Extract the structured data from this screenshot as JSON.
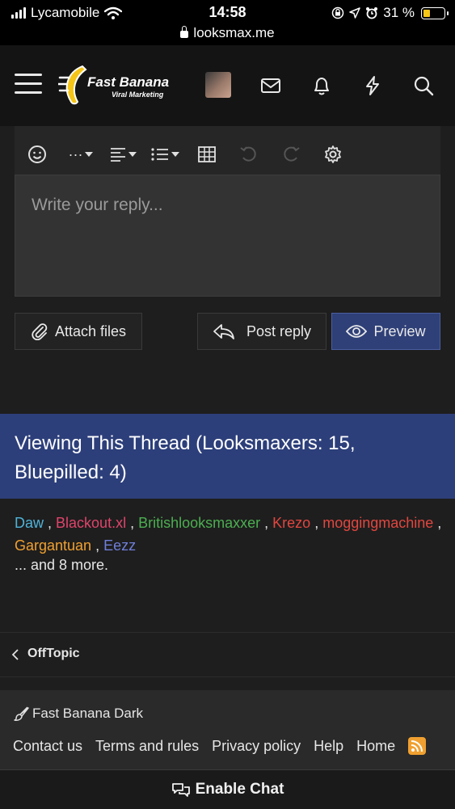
{
  "status_bar": {
    "carrier": "Lycamobile",
    "time": "14:58",
    "battery_percent": "31 %",
    "url": "looksmax.me",
    "icons": [
      "signal-icon",
      "wifi-icon",
      "screen-lock-icon",
      "location-icon",
      "alarm-icon",
      "battery-icon",
      "lock-icon"
    ]
  },
  "header": {
    "logo_brand": "Fast Banana",
    "logo_tagline": "Viral Marketing",
    "icons": [
      "menu-icon",
      "avatar",
      "inbox-icon",
      "bell-icon",
      "lightning-icon",
      "search-icon"
    ]
  },
  "editor": {
    "placeholder": "Write your reply...",
    "toolbar_icons": [
      "smiley-icon",
      "more-options-icon",
      "align-icon",
      "list-icon",
      "table-icon",
      "undo-icon",
      "redo-icon",
      "gear-icon"
    ],
    "more_label": "···"
  },
  "actions": {
    "attach": "Attach files",
    "post": "Post reply",
    "preview": "Preview"
  },
  "viewing": {
    "title": "Viewing This Thread (Looksmaxers: 15, Bluepilled: 4)",
    "users": [
      {
        "name": "Daw",
        "color": "#4fb3d9"
      },
      {
        "name": "Blackout.xl",
        "color": "#e0446b"
      },
      {
        "name": "Britishlooksmaxxer",
        "color": "#4caf50"
      },
      {
        "name": "Krezo",
        "color": "#e2463f"
      },
      {
        "name": "moggingmachine",
        "color": "#e2463f"
      },
      {
        "name": "Gargantuan",
        "color": "#f0a030"
      },
      {
        "name": "Eezz",
        "color": "#6f7fd8"
      }
    ],
    "more": "... and 8 more."
  },
  "breadcrumb": {
    "label": "OffTopic"
  },
  "footer": {
    "style": "Fast Banana Dark",
    "links": [
      "Contact us",
      "Terms and rules",
      "Privacy policy",
      "Help",
      "Home"
    ]
  },
  "chat": {
    "label": "Enable Chat"
  },
  "colors": {
    "accent": "#2d3f7a",
    "background": "#1e1e1e",
    "logo_yellow": "#f5c518"
  }
}
